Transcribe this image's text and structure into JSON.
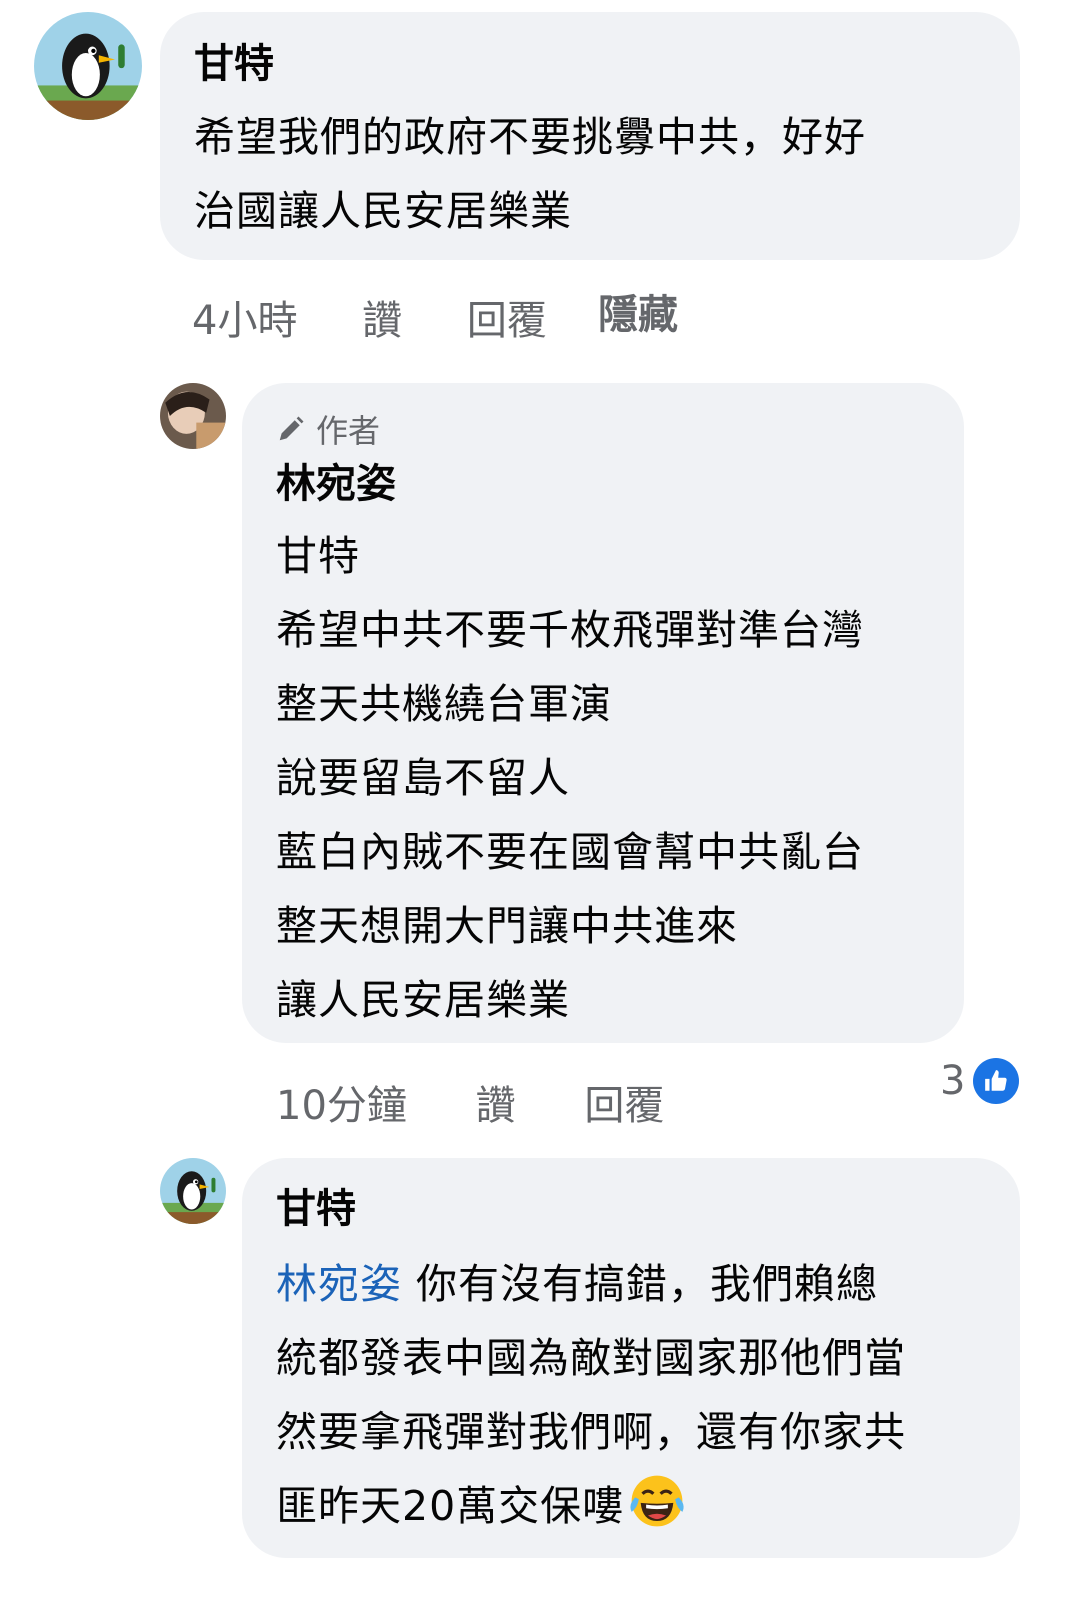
{
  "comments": [
    {
      "author": "甘特",
      "text_lines": [
        "希望我們的政府不要挑釁中共，好好",
        "治國讓人民安居樂業"
      ],
      "meta": {
        "time": "4小時",
        "like": "讚",
        "reply": "回覆",
        "hide": "隱藏"
      }
    },
    {
      "badge": "作者",
      "author": "林宛姿",
      "text_lines": [
        "甘特",
        "希望中共不要千枚飛彈對準台灣",
        "整天共機繞台軍演",
        "說要留島不留人",
        "藍白內賊不要在國會幫中共亂台",
        "整天想開大門讓中共進來",
        "讓人民安居樂業"
      ],
      "meta": {
        "time": "10分鐘",
        "like": "讚",
        "reply": "回覆"
      },
      "reactions": {
        "count": "3",
        "icon": "thumbs-up-icon",
        "color": "#1b74e4"
      }
    },
    {
      "author": "甘特",
      "mention": "林宛姿",
      "text_lines": [
        " 你有沒有搞錯，我們賴總",
        "統都發表中國為敵對國家那他們當",
        "然要拿飛彈對我們啊，還有你家共",
        "匪昨天20萬交保嘍"
      ],
      "emoji": "tears-of-joy-emoji"
    }
  ],
  "colors": {
    "bubble": "#f0f2f5",
    "meta": "#65676b",
    "mention": "#1b63b8",
    "like": "#1b74e4"
  }
}
